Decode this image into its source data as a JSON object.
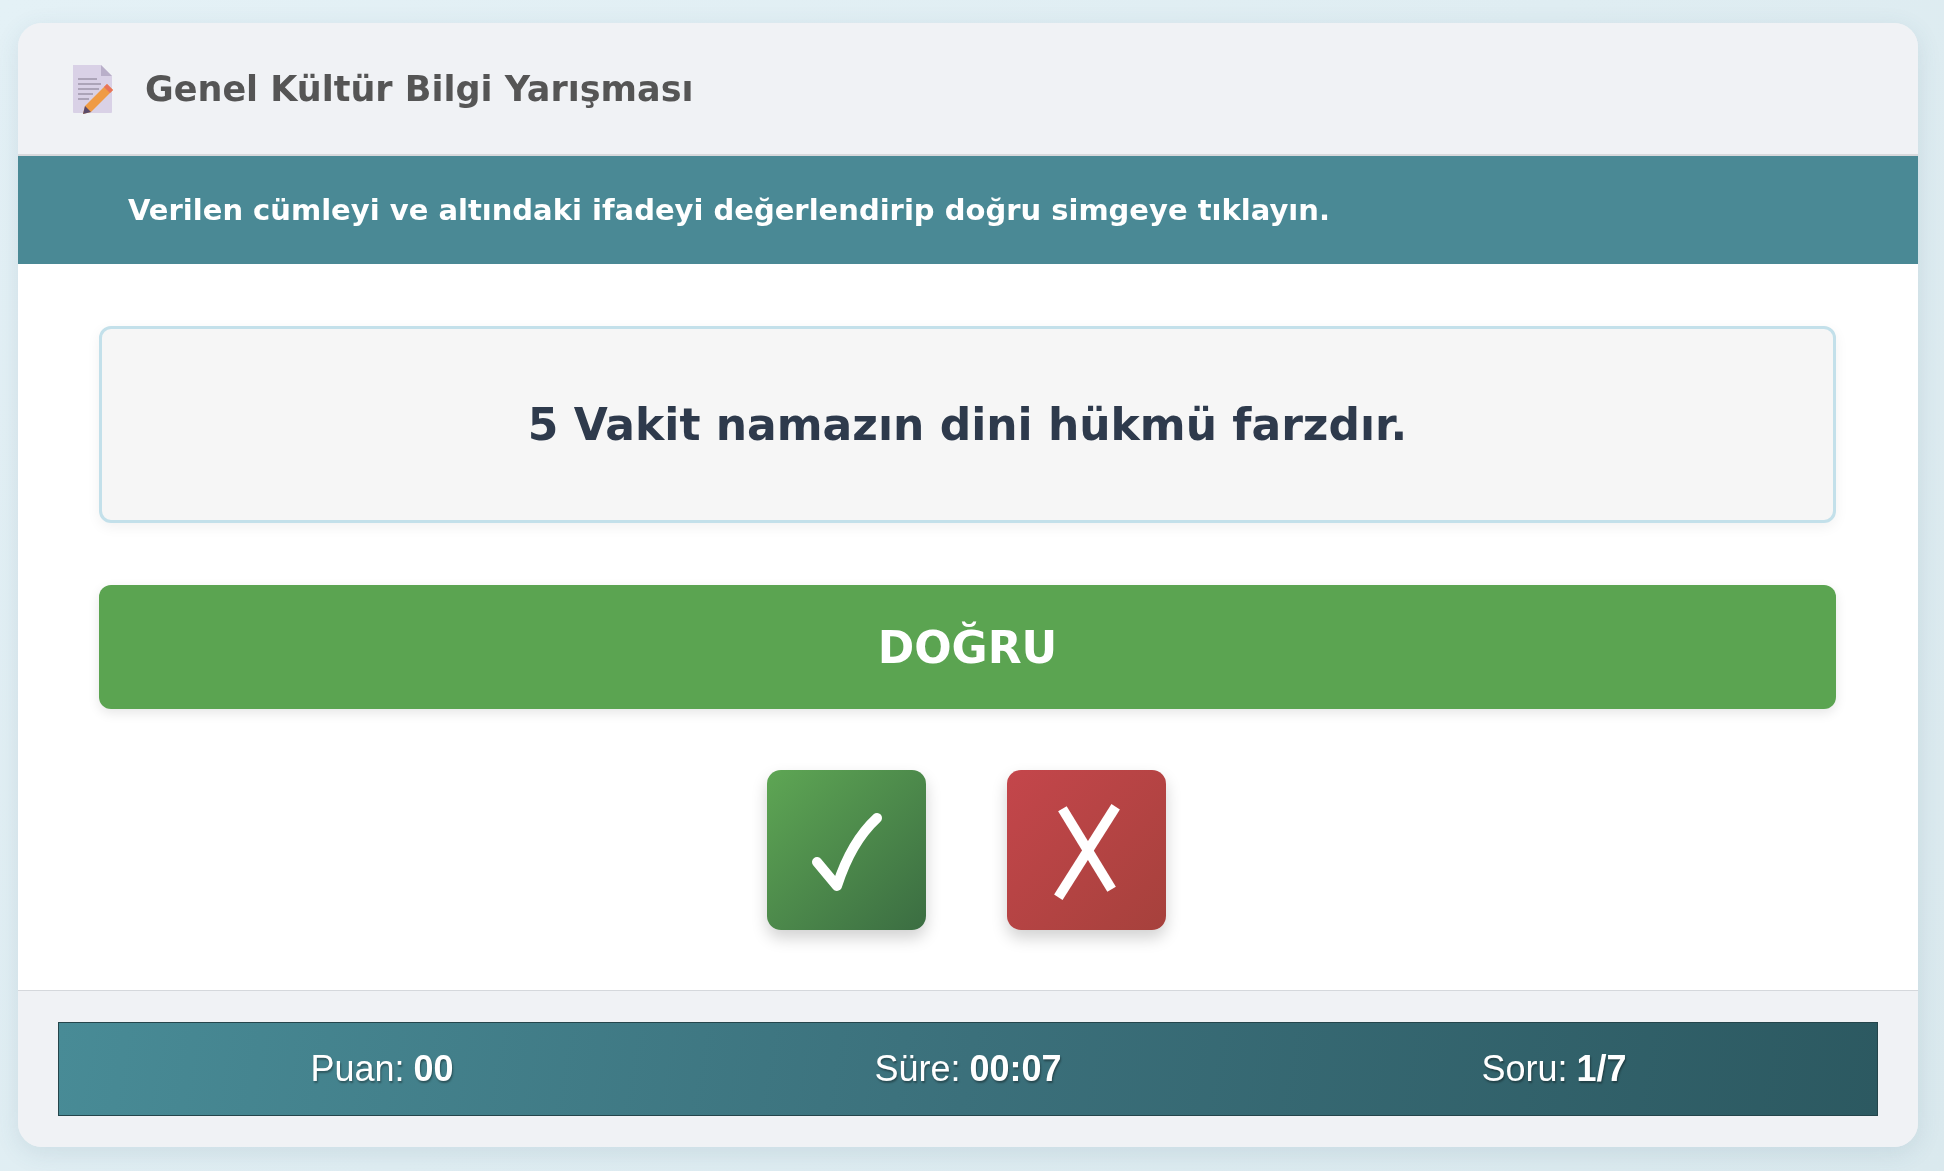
{
  "header": {
    "title": "Genel Kültür Bilgi Yarışması"
  },
  "instruction": "Verilen cümleyi ve altındaki ifadeyi değerlendirip doğru simgeye tıklayın.",
  "question": {
    "statement": "5 Vakit namazın dini hükmü farzdır.",
    "claim": "DOĞRU"
  },
  "answer_buttons": [
    {
      "kind": "correct"
    },
    {
      "kind": "wrong"
    }
  ],
  "status_bar": [
    {
      "label": "Puan:",
      "value": "00"
    },
    {
      "label": "Süre:",
      "value": "00:07"
    },
    {
      "label": "Soru:",
      "value": "1/7"
    }
  ]
}
